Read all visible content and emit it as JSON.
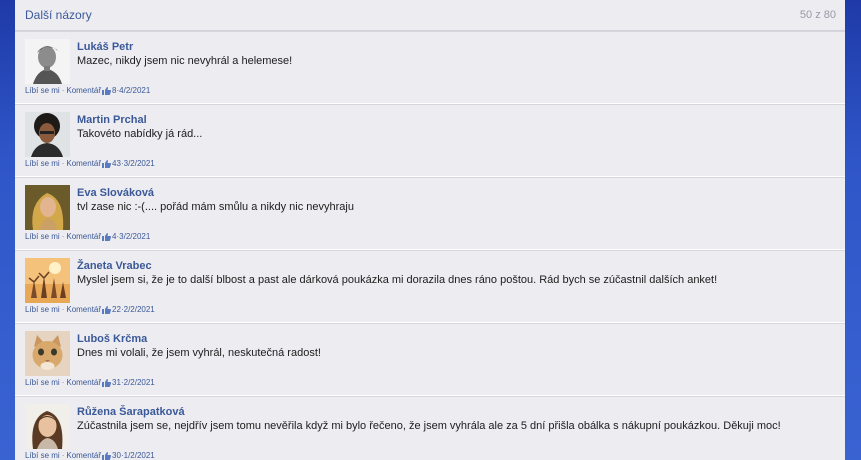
{
  "header": {
    "title": "Další názory",
    "count": "50 z 80"
  },
  "meta_labels": {
    "like": "Líbí se mi",
    "dot": "·",
    "comment": "Komentář"
  },
  "comments": [
    {
      "author": "Lukáš Petr",
      "text": "Mazec, nikdy jsem nic nevyhrál a helemese!",
      "likes": "8",
      "date": "·4/2/2021",
      "avatar_icon": "man-portrait-bw"
    },
    {
      "author": "Martin Prchal",
      "text": "Takovéto nabídky já rád...",
      "likes": "43",
      "date": "·3/2/2021",
      "avatar_icon": "man-curly-hair"
    },
    {
      "author": "Eva Slováková",
      "text": "tvl zase nic :-(.... pořád mám smůlu a nikdy nic nevyhraju",
      "likes": "4",
      "date": "·3/2/2021",
      "avatar_icon": "woman-blonde"
    },
    {
      "author": "Žaneta Vrabec",
      "text": "Myslel jsem si, že je to další blbost a past ale dárková poukázka mi dorazila dnes ráno poštou. Rád bych se zúčastnil dalších anket!",
      "likes": "22",
      "date": "·2/2/2021",
      "avatar_icon": "beach-people"
    },
    {
      "author": "Luboš Krčma",
      "text": "Dnes mi volali, že jsem vyhrál, neskutečná radost!",
      "likes": "31",
      "date": "·2/2/2021",
      "avatar_icon": "cat"
    },
    {
      "author": "Růžena Šarapatková",
      "text": "Zúčastnila jsem se, nejdřív jsem tomu nevěřila když mi bylo řečeno, že jsem vyhrála ale za 5 dní přišla obálka s nákupní poukázkou. Děkuji moc!",
      "likes": "30",
      "date": "·1/2/2021",
      "avatar_icon": "woman-brown-hair"
    }
  ],
  "colors": {
    "background": "#2f56c8",
    "panel": "#ececf1",
    "link": "#3b5998"
  }
}
